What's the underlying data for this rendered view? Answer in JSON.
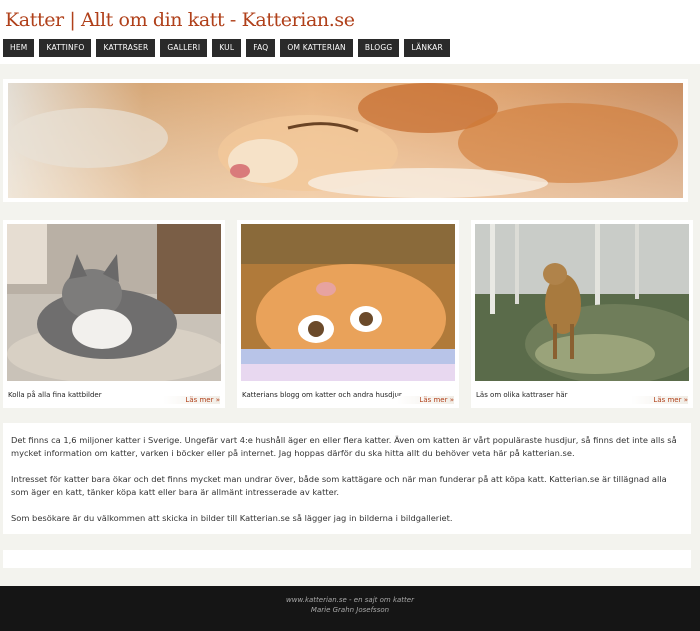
{
  "header": {
    "title": "Katter | Allt om din katt - Katterian.se"
  },
  "nav": [
    {
      "label": "HEM"
    },
    {
      "label": "KATTINFO"
    },
    {
      "label": "KATTRASER"
    },
    {
      "label": "GALLERI"
    },
    {
      "label": "KUL"
    },
    {
      "label": "FAQ"
    },
    {
      "label": "OM KATTERIAN"
    },
    {
      "label": "BLOGG"
    },
    {
      "label": "LÄNKAR"
    }
  ],
  "cards": [
    {
      "caption": "Kolla på alla fina kattbilder",
      "more": "Läs mer »"
    },
    {
      "caption": "Katterians blogg om katter och andra husdjur",
      "more": "Läs mer »"
    },
    {
      "caption": "Läs om olika kattraser här",
      "more": "Läs mer »"
    }
  ],
  "content": {
    "paragraphs": [
      "Det finns ca 1,6 miljoner katter i Sverige. Ungefär vart 4:e hushåll äger en eller flera katter. Även om katten är vårt populäraste husdjur, så finns det inte alls så mycket information om katter, varken i böcker eller på internet. Jag hoppas därför du ska hitta allt du behöver veta här på katterian.se.",
      "Intresset för katter bara ökar och det finns mycket man undrar över, både som kattägare och när man funderar på att köpa katt. Katterian.se är tillägnad alla som äger en katt, tänker köpa katt eller bara är allmänt intresserade av katter.",
      "Som besökare är du välkommen att skicka in bilder till Katterian.se så lägger jag in bilderna i bildgalleriet."
    ]
  },
  "footer": {
    "line1": "www.katterian.se - en sajt om katter",
    "line2": "Marie Grahn Josefsson"
  },
  "colors": {
    "brand": "#b0401a",
    "nav_bg": "#2a2a2a",
    "page_bg": "#f3f3ee",
    "footer_bg": "#151515"
  }
}
